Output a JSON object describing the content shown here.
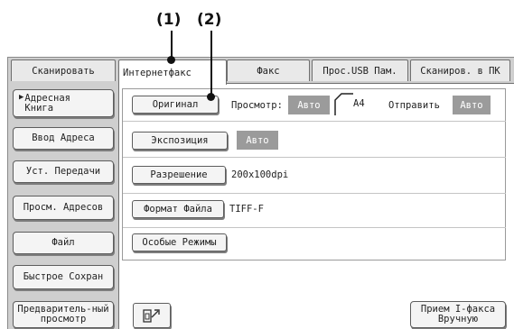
{
  "callouts": {
    "c1": "(1)",
    "c2": "(2)"
  },
  "tabs": [
    {
      "label": "Сканировать"
    },
    {
      "label": "Интернетфакс"
    },
    {
      "label": "Факс"
    },
    {
      "label": "Прос.USB Пам."
    },
    {
      "label": "Сканиров. в ПК"
    }
  ],
  "left_buttons": {
    "address_book": "Адресная Книга",
    "address_entry": "Ввод Адреса",
    "send_settings": "Уст. Передачи",
    "address_review": "Просм. Адресов",
    "file": "Файл",
    "quick_save": "Быстрое Сохран",
    "preview": "Предваритель-ный просмотр"
  },
  "main": {
    "original_button": "Оригинал",
    "preview_label": "Просмотр:",
    "preview_value": "Авто",
    "paper_size": "A4",
    "send_label": "Отправить",
    "send_value": "Авто",
    "exposure_button": "Экспозиция",
    "exposure_value": "Авто",
    "resolution_button": "Разрешение",
    "resolution_value": "200x100dpi",
    "file_format_button": "Формат Файла",
    "file_format_value": "TIFF-F",
    "special_modes_button": "Особые Режимы",
    "manual_receive_button": "Прием I-факса Вручную"
  }
}
